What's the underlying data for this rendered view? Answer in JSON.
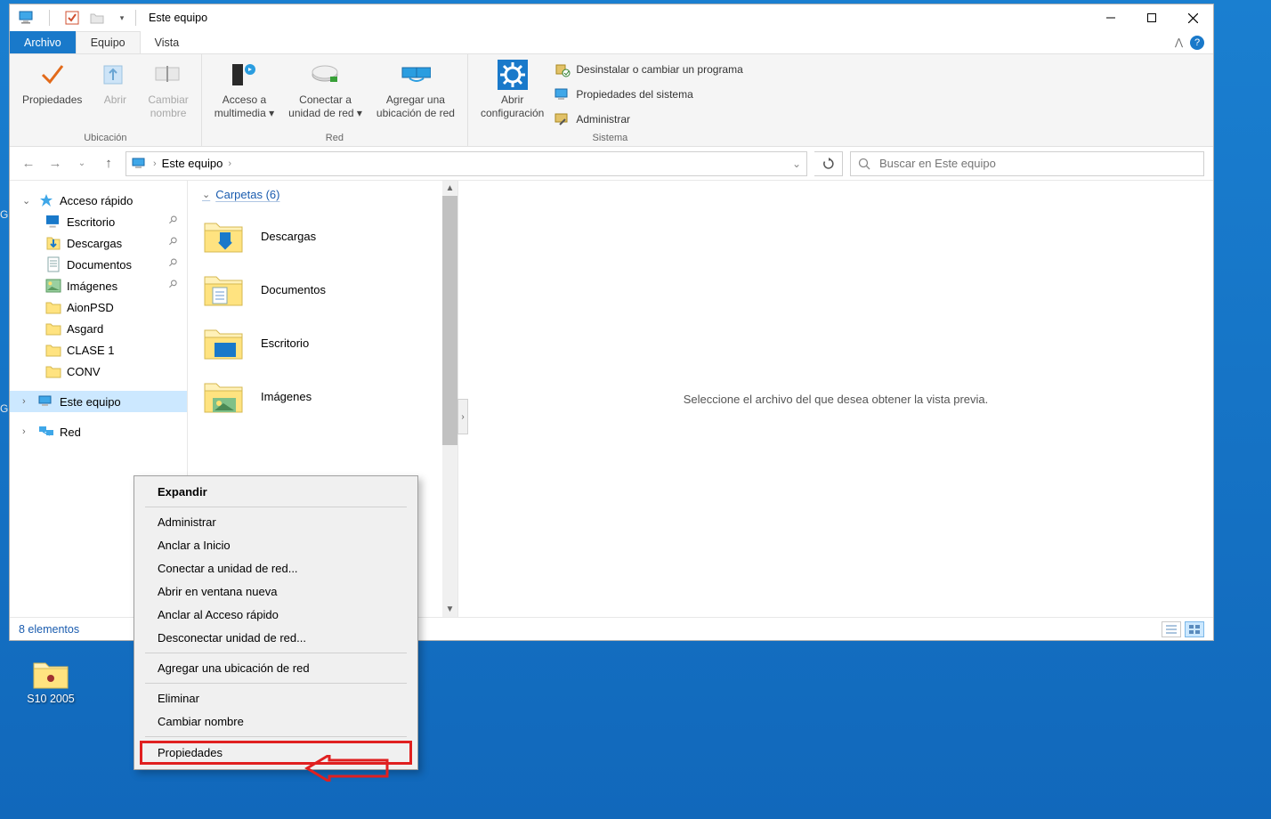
{
  "titlebar": {
    "title": "Este equipo"
  },
  "ribbon": {
    "tabs": {
      "file": "Archivo",
      "equipo": "Equipo",
      "vista": "Vista"
    },
    "ubicacion": {
      "label": "Ubicación",
      "propiedades": "Propiedades",
      "abrir": "Abrir",
      "cambiar_nombre_l1": "Cambiar",
      "cambiar_nombre_l2": "nombre"
    },
    "red": {
      "label": "Red",
      "acceso_l1": "Acceso a",
      "acceso_l2": "multimedia",
      "conectar_l1": "Conectar a",
      "conectar_l2": "unidad de red",
      "agregar_l1": "Agregar una",
      "agregar_l2": "ubicación de red"
    },
    "sistema": {
      "label": "Sistema",
      "abrir_config_l1": "Abrir",
      "abrir_config_l2": "configuración",
      "desinstalar": "Desinstalar o cambiar un programa",
      "prop_sistema": "Propiedades del sistema",
      "administrar": "Administrar"
    }
  },
  "breadcrumb": {
    "root": "Este equipo"
  },
  "search": {
    "placeholder": "Buscar en Este equipo"
  },
  "navpane": {
    "quick": "Acceso rápido",
    "items": [
      {
        "label": "Escritorio",
        "pinned": true,
        "icon": "desktop"
      },
      {
        "label": "Descargas",
        "pinned": true,
        "icon": "download"
      },
      {
        "label": "Documentos",
        "pinned": true,
        "icon": "document"
      },
      {
        "label": "Imágenes",
        "pinned": true,
        "icon": "pictures"
      },
      {
        "label": "AionPSD",
        "pinned": false,
        "icon": "folder"
      },
      {
        "label": "Asgard",
        "pinned": false,
        "icon": "folder"
      },
      {
        "label": "CLASE 1",
        "pinned": false,
        "icon": "folder"
      },
      {
        "label": "CONV",
        "pinned": false,
        "icon": "folder"
      }
    ],
    "thispc": "Este equipo",
    "network": "Red"
  },
  "content": {
    "folders_header": "Carpetas (6)",
    "items": [
      {
        "label": "Descargas",
        "icon": "download"
      },
      {
        "label": "Documentos",
        "icon": "document"
      },
      {
        "label": "Escritorio",
        "icon": "desktop"
      },
      {
        "label": "Imágenes",
        "icon": "pictures"
      }
    ]
  },
  "preview": {
    "empty": "Seleccione el archivo del que desea obtener la vista previa."
  },
  "statusbar": {
    "count": "8 elementos"
  },
  "contextmenu": {
    "expand": "Expandir",
    "administrar": "Administrar",
    "anclar_inicio": "Anclar a Inicio",
    "conectar_unidad": "Conectar a unidad de red...",
    "abrir_ventana": "Abrir en ventana nueva",
    "anclar_acceso": "Anclar al Acceso rápido",
    "desconectar": "Desconectar unidad de red...",
    "agregar_ubic": "Agregar una ubicación de red",
    "eliminar": "Eliminar",
    "cambiar_nombre": "Cambiar nombre",
    "propiedades": "Propiedades"
  },
  "desktop": {
    "s10": "S10 2005"
  }
}
